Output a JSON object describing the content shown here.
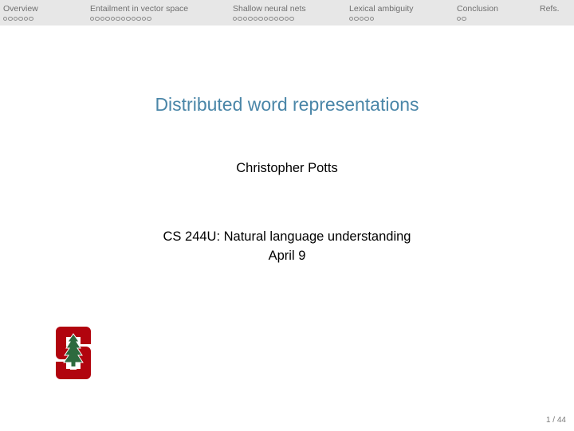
{
  "nav": {
    "sections": [
      {
        "label": "Overview",
        "dots": 6
      },
      {
        "label": "Entailment in vector space",
        "dots": 12
      },
      {
        "label": "Shallow neural nets",
        "dots": 12
      },
      {
        "label": "Lexical ambiguity",
        "dots": 5
      },
      {
        "label": "Conclusion",
        "dots": 2
      },
      {
        "label": "Refs.",
        "dots": 0
      }
    ]
  },
  "slide": {
    "title": "Distributed word representations",
    "author": "Christopher Potts",
    "course": "CS 244U: Natural language understanding",
    "date": "April 9"
  },
  "logo": {
    "icon": "stanford-s-tree-logo-icon",
    "color": "#b1040e",
    "tree_color": "#2d6a3e"
  },
  "page_number": "1 / 44",
  "colors": {
    "title": "#4a86a8",
    "navbar": "#e7e7e7"
  }
}
